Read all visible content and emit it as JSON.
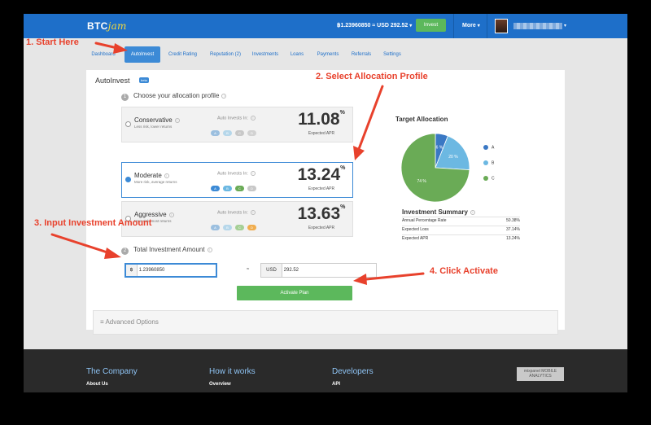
{
  "app": {
    "logo_main": "BTC",
    "logo_accent": "jam",
    "balance": "฿1.23960850 ≈ USD 292.52",
    "invest_button": "Invest",
    "more_menu": "More"
  },
  "tabs": [
    "Dashboard",
    "AutoInvest",
    "Credit Rating",
    "Reputation (2)",
    "Investments",
    "Loans",
    "Payments",
    "Referrals",
    "Settings"
  ],
  "panel": {
    "title": "AutoInvest",
    "beta": "beta",
    "step1_num": "1",
    "step1": "Choose your allocation profile",
    "step2_num": "2",
    "step2": "Total Investment Amount",
    "auto_invests_label": "Auto Invests In:",
    "apr_label": "Expected APR",
    "profiles": [
      {
        "name": "Conservative",
        "desc": "Less risk, lower returns",
        "apr": "11.08",
        "selected": false,
        "badges": [
          "A",
          "B",
          "C",
          "D"
        ]
      },
      {
        "name": "Moderate",
        "desc": "More risk, average returns",
        "apr": "13.24",
        "selected": true,
        "badges": [
          "A",
          "B",
          "C",
          "D"
        ]
      },
      {
        "name": "Aggressive",
        "desc": "Most risk, most returns",
        "apr": "13.63",
        "selected": false,
        "badges": [
          "A",
          "B",
          "C",
          "D"
        ]
      }
    ],
    "btc_prefix": "฿",
    "btc_amount": "1.23960850",
    "approx": "≈",
    "usd_prefix": "USD",
    "usd_amount": "292.52",
    "activate_button": "Activate Plan",
    "advanced_options": "Advanced Options"
  },
  "target_allocation": {
    "title": "Target Allocation",
    "legend": [
      "A",
      "B",
      "C"
    ]
  },
  "chart_data": {
    "type": "pie",
    "title": "Target Allocation",
    "categories": [
      "A",
      "B",
      "C"
    ],
    "values": [
      6,
      20,
      74
    ],
    "slice_labels": [
      "6 %",
      "20 %",
      "74 %"
    ],
    "colors": [
      "#3a78c4",
      "#6cb8e2",
      "#6aab56"
    ],
    "legend_position": "right"
  },
  "investment_summary": {
    "title": "Investment Summary",
    "rows": [
      {
        "label": "Annual Percentage Rate",
        "value": "50.38%"
      },
      {
        "label": "Expected Loss",
        "value": "37.14%"
      },
      {
        "label": "Expected APR",
        "value": "13.24%"
      }
    ]
  },
  "footer": {
    "columns": [
      {
        "heading": "The Company",
        "link": "About Us"
      },
      {
        "heading": "How it works",
        "link": "Overview"
      },
      {
        "heading": "Developers",
        "link": "API"
      }
    ],
    "badge": "mixpanel MOBILE ANALYTICS"
  },
  "annotations": [
    "1. Start Here",
    "2. Select Allocation Profile",
    "3. Input Investment Amount",
    "4. Click Activate"
  ],
  "colors": {
    "brand_blue": "#1e6fc9",
    "active_tab": "#3c8ad6",
    "green": "#5cb85c",
    "annotation_red": "#e8412c"
  }
}
